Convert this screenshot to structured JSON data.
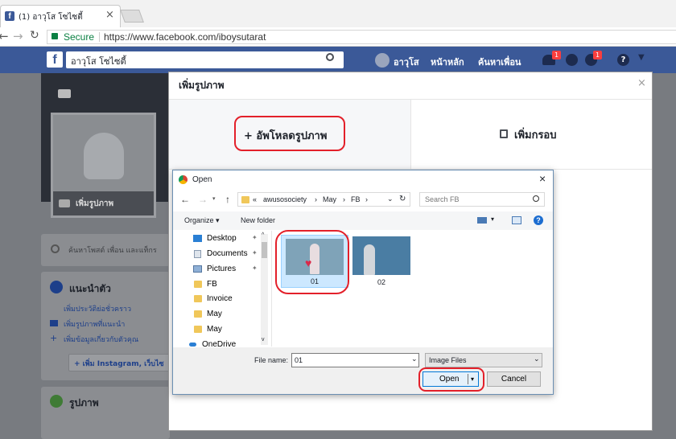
{
  "browser": {
    "tab_title": "(1) อาวุโส โซไซตี้",
    "secure_label": "Secure",
    "url": "https://www.facebook.com/iboysutarat"
  },
  "facebook": {
    "search_text": "อาวุโส โซไซตี้",
    "user_name": "อาวุโส",
    "nav_home": "หน้าหลัก",
    "nav_find_friends": "ค้นหาเพื่อน",
    "friend_requests_count": "1",
    "notifications_count": "1"
  },
  "profile": {
    "add_photo_label": "เพิ่มรูปภาพ",
    "search_posts_placeholder": "ค้นหาโพสต์ เพื่อน และแท็กร",
    "intro_heading": "แนะนำตัว",
    "intro_items": [
      "เพิ่มประวัติย่อชั่วคราว",
      "เพิ่มรูปภาพที่แนะนำ",
      "เพิ่มข้อมูลเกี่ยวกับตัวคุณ"
    ],
    "add_instagram_label": "+ เพิ่ม Instagram, เว็บไซ",
    "photos_heading": "รูปภาพ"
  },
  "modal": {
    "title": "เพิ่มรูปภาพ",
    "upload_label": "+ อัพโหลดรูปภาพ",
    "add_frame_label": "เพิ่มกรอบ"
  },
  "dialog": {
    "title": "Open",
    "breadcrumb_parts": [
      "«",
      "awusosociety",
      "May",
      "FB"
    ],
    "search_placeholder": "Search FB",
    "organize_label": "Organize ▾",
    "new_folder_label": "New folder",
    "nav_items": [
      "Desktop",
      "Documents",
      "Pictures",
      "FB",
      "Invoice",
      "May",
      "May",
      "OneDrive"
    ],
    "files": [
      {
        "name": "01",
        "selected": true
      },
      {
        "name": "02",
        "selected": false
      }
    ],
    "file_name_label": "File name:",
    "file_name_value": "01",
    "file_type_value": "Image Files",
    "open_label": "Open",
    "cancel_label": "Cancel"
  },
  "colors": {
    "facebook_blue": "#3b5998",
    "highlight_red": "#e3202a",
    "selection_blue": "#cce8ff",
    "badge_red": "#fa3e3e"
  }
}
